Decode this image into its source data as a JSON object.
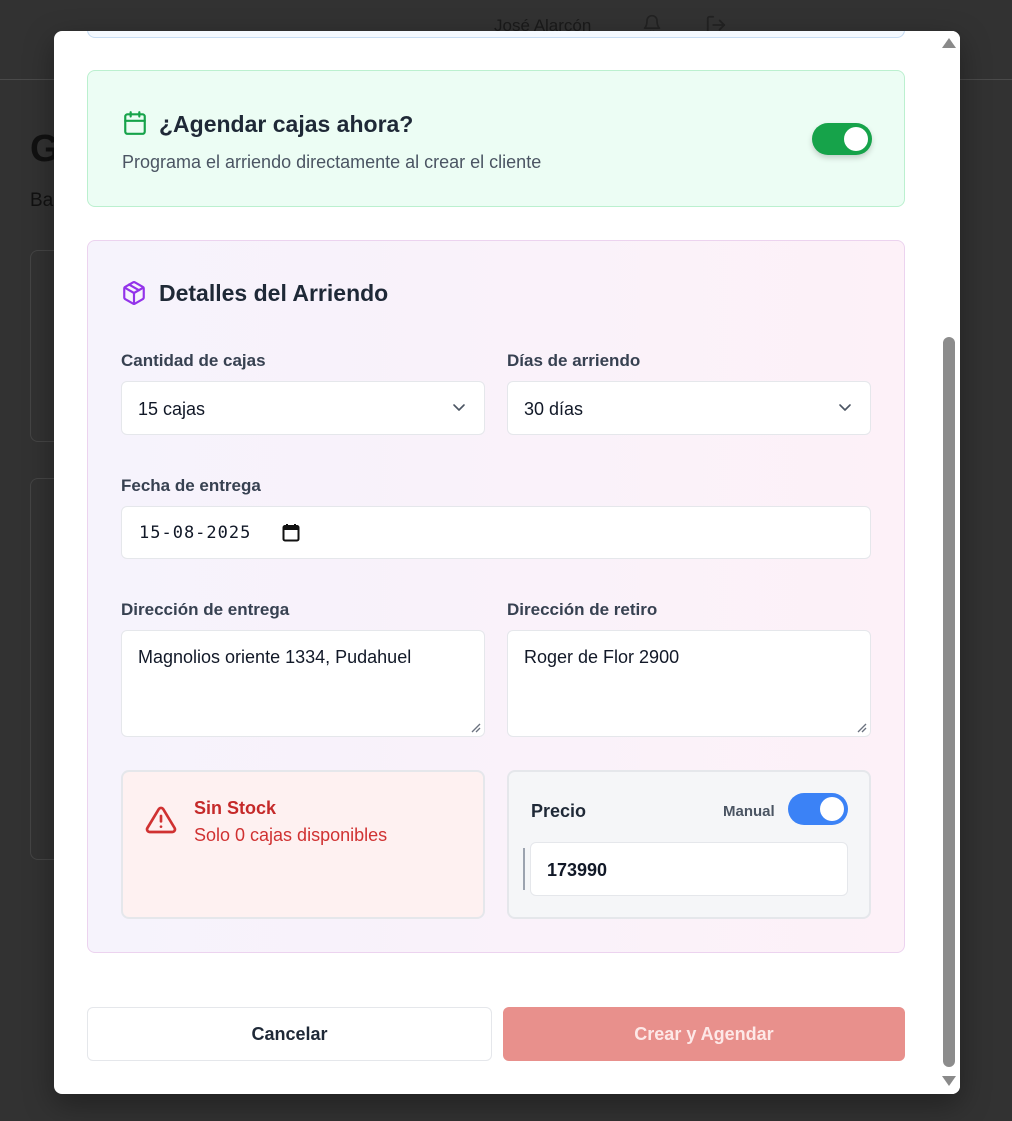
{
  "background": {
    "user_name": "José Alarcón",
    "page_title_fragment": "G",
    "page_subtitle_fragment": "Ba"
  },
  "schedule": {
    "title": "¿Agendar cajas ahora?",
    "subtitle": "Programa el arriendo directamente al crear el cliente",
    "enabled": true,
    "accent_color": "#16a34a"
  },
  "details": {
    "title": "Detalles del Arriendo",
    "box_quantity": {
      "label": "Cantidad de cajas",
      "value": "15 cajas"
    },
    "rental_days": {
      "label": "Días de arriendo",
      "value": "30 días"
    },
    "delivery_date": {
      "label": "Fecha de entrega",
      "value": "15-08-2025"
    },
    "delivery_address": {
      "label": "Dirección de entrega",
      "value": "Magnolios oriente 1334, Pudahuel"
    },
    "pickup_address": {
      "label": "Dirección de retiro",
      "value": "Roger de Flor 2900"
    }
  },
  "stock_alert": {
    "title": "Sin Stock",
    "message": "Solo 0 cajas disponibles",
    "color": "#d03232"
  },
  "price": {
    "label": "Precio",
    "mode_label": "Manual",
    "manual_enabled": true,
    "value": "173990",
    "toggle_color": "#3b82f6"
  },
  "actions": {
    "cancel_label": "Cancelar",
    "submit_label": "Crear y Agendar",
    "submit_color": "#e8908c"
  }
}
